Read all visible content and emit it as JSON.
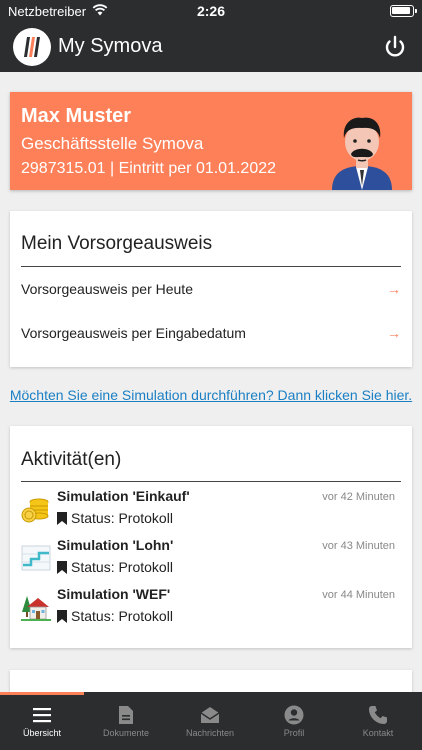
{
  "status_bar": {
    "carrier": "Netzbetreiber",
    "time": "2:26"
  },
  "header": {
    "title": "My Symova"
  },
  "profile": {
    "name": "Max Muster",
    "office": "Geschäftsstelle Symova",
    "meta": "2987315.01 | Eintritt per 01.01.2022"
  },
  "vorsorgeausweis": {
    "title": "Mein Vorsorgeausweis",
    "items": [
      {
        "label": "Vorsorgeausweis per Heute",
        "arrow": "→"
      },
      {
        "label": "Vorsorgeausweis per Eingabedatum",
        "arrow": "→"
      }
    ]
  },
  "simulation_link": "Möchten Sie eine Simulation durchführen? Dann klicken Sie hier.",
  "activities": {
    "title": "Aktivität(en)",
    "items": [
      {
        "title": "Simulation 'Einkauf'",
        "status": "Status: Protokoll",
        "time": "vor 42 Minuten",
        "icon": "coins-icon"
      },
      {
        "title": "Simulation 'Lohn'",
        "status": "Status: Protokoll",
        "time": "vor 43 Minuten",
        "icon": "salary-chart-icon"
      },
      {
        "title": "Simulation 'WEF'",
        "status": "Status: Protokoll",
        "time": "vor 44 Minuten",
        "icon": "house-icon"
      }
    ]
  },
  "tabs": [
    {
      "label": "Übersicht",
      "icon": "menu-icon",
      "active": true
    },
    {
      "label": "Dokumente",
      "icon": "document-icon",
      "active": false
    },
    {
      "label": "Nachrichten",
      "icon": "mail-icon",
      "active": false
    },
    {
      "label": "Profil",
      "icon": "profile-icon",
      "active": false
    },
    {
      "label": "Kontakt",
      "icon": "phone-icon",
      "active": false
    }
  ],
  "colors": {
    "accent": "#fd8059",
    "header": "#2b2d2e",
    "link": "#1b7fc4"
  }
}
